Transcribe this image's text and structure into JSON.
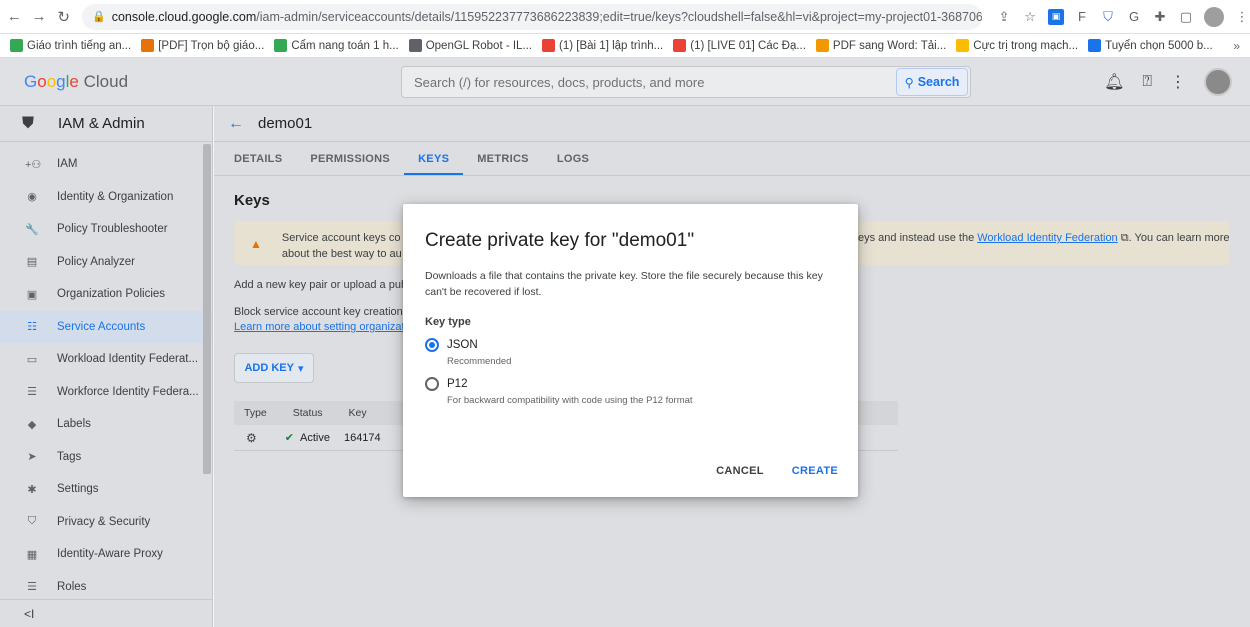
{
  "browser": {
    "url_domain": "console.cloud.google.com",
    "url_path": "/iam-admin/serviceaccounts/details/115952237773686223839;edit=true/keys?cloudshell=false&hl=vi&project=my-project01-368706",
    "bookmarks": [
      {
        "label": "Giáo trình tiếng an...",
        "color": "#34a853"
      },
      {
        "label": "[PDF] Trọn bộ giáo...",
        "color": "#e8710a"
      },
      {
        "label": "Cẩm nang toán 1 h...",
        "color": "#34a853"
      },
      {
        "label": "OpenGL Robot - IL...",
        "color": "#5f6368"
      },
      {
        "label": "(1) [Bài 1] lập trình...",
        "color": "#ea4335"
      },
      {
        "label": "(1) [LIVE 01] Các Đạ...",
        "color": "#ea4335"
      },
      {
        "label": "PDF sang Word: Tải...",
        "color": "#f29900"
      },
      {
        "label": "Cực trị trong mạch...",
        "color": "#fbbc05"
      },
      {
        "label": "Tuyển chọn 5000 b...",
        "color": "#1a73e8"
      }
    ],
    "bookmarks_more": "»"
  },
  "header": {
    "logo_word1": "Google",
    "logo_word2": "Cloud",
    "search_placeholder": "Search (/) for resources, docs, products, and more",
    "search_button": "Search"
  },
  "sidebar": {
    "title": "IAM & Admin",
    "items": [
      {
        "label": "IAM",
        "icon": "person-add-icon",
        "glyph": "+⚇"
      },
      {
        "label": "Identity & Organization",
        "icon": "account-circle-icon",
        "glyph": "◉"
      },
      {
        "label": "Policy Troubleshooter",
        "icon": "wrench-icon",
        "glyph": "🔧"
      },
      {
        "label": "Policy Analyzer",
        "icon": "document-search-icon",
        "glyph": "▤"
      },
      {
        "label": "Organization Policies",
        "icon": "list-box-icon",
        "glyph": "▣"
      },
      {
        "label": "Service Accounts",
        "icon": "service-account-icon",
        "glyph": "☷",
        "active": true
      },
      {
        "label": "Workload Identity Federat...",
        "icon": "id-card-icon",
        "glyph": "▭"
      },
      {
        "label": "Workforce Identity Federa...",
        "icon": "list-icon",
        "glyph": "☰"
      },
      {
        "label": "Labels",
        "icon": "tag-icon",
        "glyph": "◆"
      },
      {
        "label": "Tags",
        "icon": "arrow-tag-icon",
        "glyph": "➤"
      },
      {
        "label": "Settings",
        "icon": "gear-icon",
        "glyph": "✱"
      },
      {
        "label": "Privacy & Security",
        "icon": "shield-icon",
        "glyph": "⛉"
      },
      {
        "label": "Identity-Aware Proxy",
        "icon": "proxy-icon",
        "glyph": "▦"
      },
      {
        "label": "Roles",
        "icon": "stack-icon",
        "glyph": "☰"
      }
    ],
    "collapse": "<I"
  },
  "main": {
    "title": "demo01",
    "tabs": [
      "DETAILS",
      "PERMISSIONS",
      "KEYS",
      "METRICS",
      "LOGS"
    ],
    "active_tab": "KEYS",
    "heading": "Keys",
    "warning_left_1": "Service account keys co",
    "warning_left_2": "about the best way to au",
    "warning_right_pre": "eys and instead use the ",
    "warning_link": "Workload Identity Federation",
    "warning_right_post": ". You can learn more",
    "add_info": "Add a new key pair or upload a publi",
    "block_text": "Block service account key creation u",
    "learn_link": "Learn more about setting organizati",
    "add_key_button": "ADD KEY",
    "table": {
      "headers": [
        "Type",
        "Status",
        "Key"
      ],
      "rows": [
        {
          "status": "Active",
          "key": "164174"
        }
      ]
    }
  },
  "modal": {
    "title": "Create private key for \"demo01\"",
    "description": "Downloads a file that contains the private key. Store the file securely because this key can't be recovered if lost.",
    "key_type_label": "Key type",
    "options": [
      {
        "label": "JSON",
        "hint": "Recommended",
        "selected": true
      },
      {
        "label": "P12",
        "hint": "For backward compatibility with code using the P12 format",
        "selected": false
      }
    ],
    "cancel": "CANCEL",
    "create": "CREATE"
  },
  "colors": {
    "accent": "#1a73e8",
    "warning": "#e37400",
    "success": "#188038"
  }
}
